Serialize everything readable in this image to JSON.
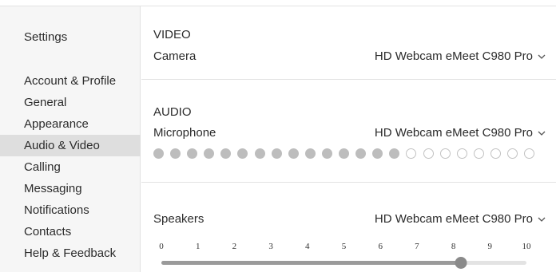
{
  "sidebar": {
    "title": "Settings",
    "items": [
      {
        "label": "Account & Profile",
        "active": false
      },
      {
        "label": "General",
        "active": false
      },
      {
        "label": "Appearance",
        "active": false
      },
      {
        "label": "Audio & Video",
        "active": true
      },
      {
        "label": "Calling",
        "active": false
      },
      {
        "label": "Messaging",
        "active": false
      },
      {
        "label": "Notifications",
        "active": false
      },
      {
        "label": "Contacts",
        "active": false
      },
      {
        "label": "Help & Feedback",
        "active": false
      }
    ]
  },
  "video": {
    "header": "VIDEO",
    "camera_label": "Camera",
    "camera_value": "HD Webcam eMeet C980 Pro"
  },
  "audio": {
    "header": "AUDIO",
    "microphone_label": "Microphone",
    "microphone_value": "HD Webcam eMeet C980 Pro",
    "level_total_dots": 23,
    "level_active_dots": 15
  },
  "speakers": {
    "label": "Speakers",
    "value": "HD Webcam eMeet C980 Pro",
    "ticks": [
      "0",
      "1",
      "2",
      "3",
      "4",
      "5",
      "6",
      "7",
      "8",
      "9",
      "10"
    ],
    "volume": 8.2,
    "volume_max": 10
  },
  "icons": {
    "dropdown": "chevron-down-icon"
  },
  "colors": {
    "active_nav_bg": "#dedede",
    "sidebar_bg": "#f6f6f6",
    "slider_fill": "#9a9a9a",
    "slider_thumb": "#8a8a8a"
  }
}
